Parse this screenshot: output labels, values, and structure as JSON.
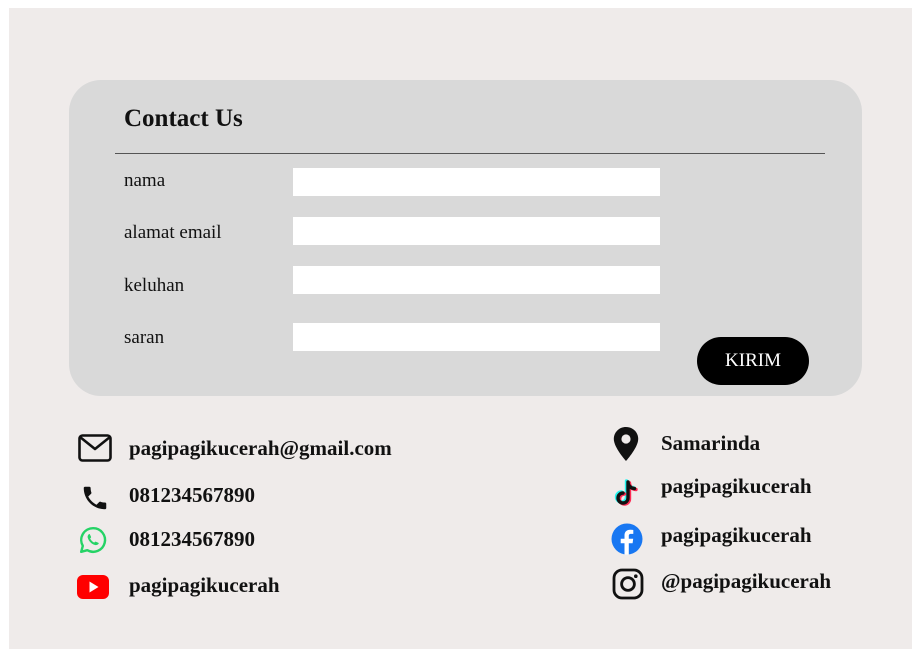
{
  "form": {
    "title": "Contact Us",
    "fields": [
      {
        "label": "nama",
        "value": ""
      },
      {
        "label": "alamat email",
        "value": ""
      },
      {
        "label": "keluhan",
        "value": ""
      },
      {
        "label": "saran",
        "value": ""
      }
    ],
    "submit_label": "KIRIM"
  },
  "contacts": {
    "left": [
      {
        "icon": "mail-icon",
        "text": "pagipagikucerah@gmail.com"
      },
      {
        "icon": "phone-icon",
        "text": "081234567890"
      },
      {
        "icon": "whatsapp-icon",
        "text": "081234567890",
        "color": "#25d366"
      },
      {
        "icon": "youtube-icon",
        "text": "pagipagikucerah",
        "color": "#ff0000"
      }
    ],
    "right": [
      {
        "icon": "location-pin-icon",
        "text": "Samarinda"
      },
      {
        "icon": "tiktok-icon",
        "text": "pagipagikucerah"
      },
      {
        "icon": "facebook-icon",
        "text": "pagipagikucerah",
        "color": "#1877f2"
      },
      {
        "icon": "instagram-icon",
        "text": "@pagipagikucerah"
      }
    ]
  },
  "colors": {
    "background": "#efebea",
    "card": "#d9d9d9",
    "button": "#000000",
    "input": "#ffffff"
  }
}
